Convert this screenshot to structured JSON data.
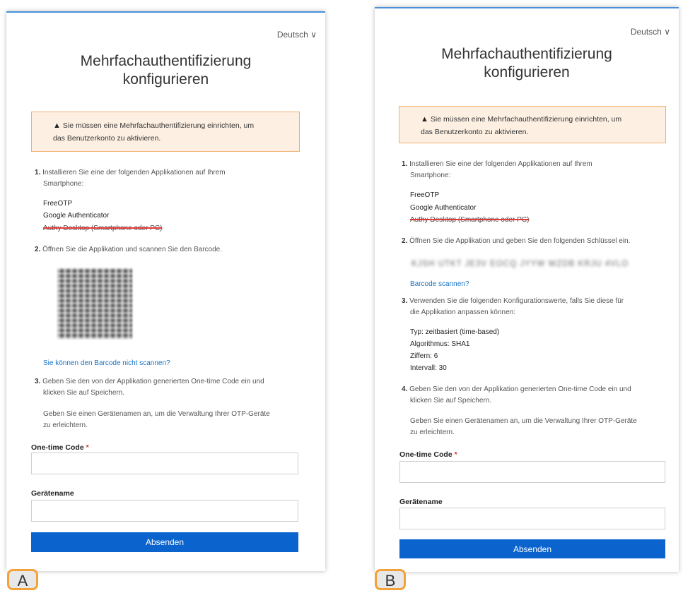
{
  "panel_a": {
    "language": "Deutsch",
    "chevron": "chevron-down-icon",
    "title_line1": "Mehrfachauthentifizierung",
    "title_line2": "konfigurieren",
    "alert_icon": "warning-triangle-icon",
    "alert_line1": "Sie müssen eine Mehrfachauthentifizierung einrichten, um",
    "alert_line2": "das Benutzerkonto zu aktivieren.",
    "step1_num": "1.",
    "step1_line1": "Installieren Sie eine der folgenden Applikationen auf Ihrem",
    "step1_line2": "Smartphone:",
    "apps": [
      "FreeOTP",
      "Google Authenticator",
      "Authy Desktop (Smartphone oder PC)"
    ],
    "step2_num": "2.",
    "step2_text": "Öffnen Sie die Applikation und scannen Sie den Barcode.",
    "barcode_link": "Sie können den Barcode nicht scannen?",
    "step3_num": "3.",
    "step3_line1": "Geben Sie den von der Applikation generierten One-time Code ein und",
    "step3_line2": "klicken Sie auf Speichern.",
    "hint_line1": "Geben Sie einen Gerätenamen an, um die Verwaltung Ihrer OTP-Geräte",
    "hint_line2": "zu erleichtern.",
    "otp_label": "One-time Code",
    "required_mark": "*",
    "otp_value": "",
    "device_label": "Gerätename",
    "device_value": "",
    "submit": "Absenden",
    "tag": "A"
  },
  "panel_b": {
    "language": "Deutsch",
    "chevron": "chevron-down-icon",
    "title_line1": "Mehrfachauthentifizierung",
    "title_line2": "konfigurieren",
    "alert_icon": "warning-triangle-icon",
    "alert_line1": "Sie müssen eine Mehrfachauthentifizierung einrichten, um",
    "alert_line2": "das Benutzerkonto zu aktivieren.",
    "step1_num": "1.",
    "step1_line1": "Installieren Sie eine der folgenden Applikationen auf Ihrem",
    "step1_line2": "Smartphone:",
    "apps": [
      "FreeOTP",
      "Google Authenticator",
      "Authy Desktop (Smartphone oder PC)"
    ],
    "step2_num": "2.",
    "step2_text": "Öffnen Sie die Applikation und geben Sie den folgenden Schlüssel ein.",
    "secret_key": "KJSH UTKT JE3V EOCQ JYYW WZDB KRJU 4VLO",
    "scan_link": "Barcode scannen?",
    "step3_num": "3.",
    "step3_line1": "Verwenden Sie die folgenden Konfigurationswerte, falls Sie diese für",
    "step3_line2": "die Applikation anpassen können:",
    "config": [
      "Typ: zeitbasiert (time-based)",
      "Algorithmus: SHA1",
      "Ziffern: 6",
      "Intervall: 30"
    ],
    "step4_num": "4.",
    "step4_line1": "Geben Sie den von der Applikation generierten One-time Code ein und",
    "step4_line2": "klicken Sie auf Speichern.",
    "hint_line1": "Geben Sie einen Gerätenamen an, um die Verwaltung Ihrer OTP-Geräte",
    "hint_line2": "zu erleichtern.",
    "otp_label": "One-time Code",
    "required_mark": "*",
    "otp_value": "",
    "device_label": "Gerätename",
    "device_value": "",
    "submit": "Absenden",
    "tag": "B"
  },
  "colors": {
    "accent": "#0b63ce",
    "link": "#1a73c2",
    "alert_bg": "#fdf0e3",
    "alert_border": "#f0b070",
    "tag_border": "#f3a23a",
    "strike": "#e53935"
  }
}
